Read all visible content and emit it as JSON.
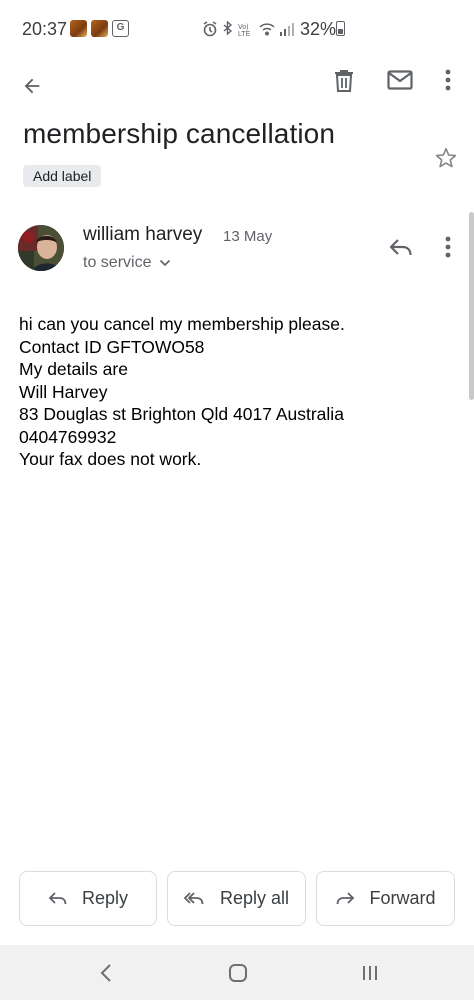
{
  "status_bar": {
    "time": "20:37",
    "battery_percent": "32%",
    "network_label": "VoLTE"
  },
  "email": {
    "subject": "membership cancellation",
    "label_button": "Add label",
    "sender_name": "william harvey",
    "date": "13 May",
    "recipient": "to service",
    "body_lines": [
      "hi can you cancel my membership please.",
      "Contact ID GFTOWO58",
      "My details are",
      "Will Harvey",
      "83 Douglas st Brighton Qld 4017 Australia",
      "0404769932",
      "Your fax does not work."
    ]
  },
  "actions": {
    "reply": "Reply",
    "reply_all": "Reply all",
    "forward": "Forward"
  },
  "icons": {
    "back": "arrow-left-icon",
    "delete": "trash-icon",
    "mark_unread": "mail-icon",
    "more": "more-vert-icon",
    "star": "star-outline-icon"
  }
}
